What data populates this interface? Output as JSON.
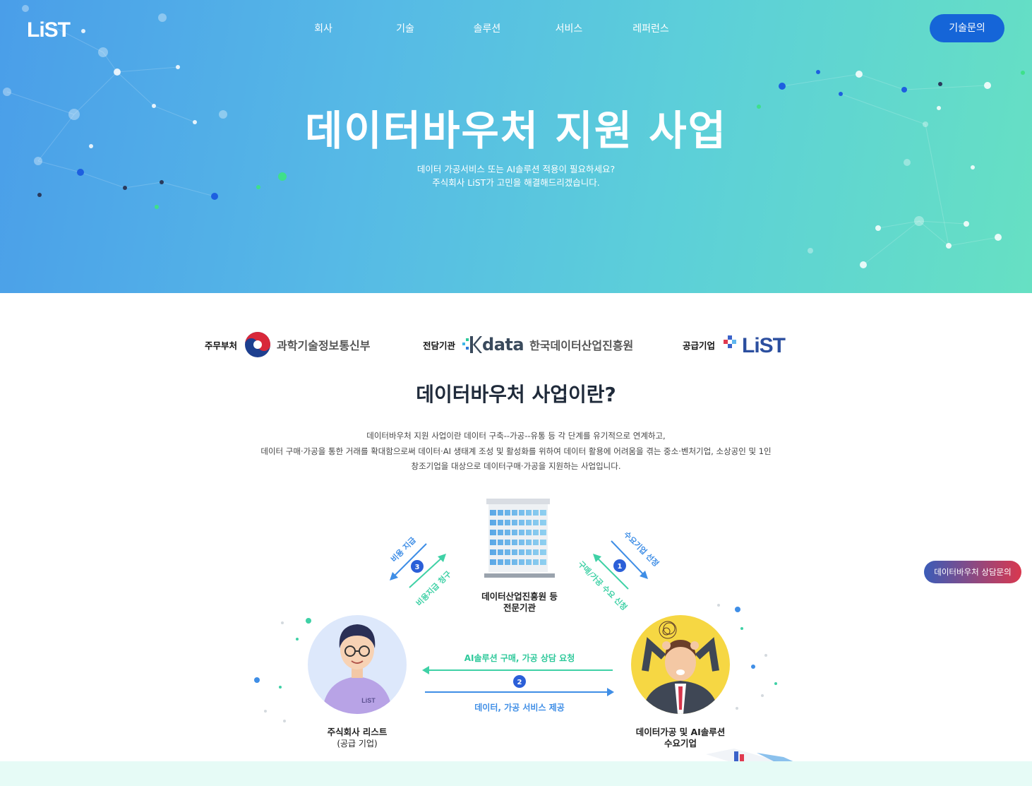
{
  "header": {
    "logo_text": "LiST",
    "nav": [
      "회사",
      "기술",
      "솔루션",
      "서비스",
      "레퍼런스"
    ],
    "cta_label": "기술문의"
  },
  "hero": {
    "title": "데이터바우처 지원 사업",
    "subtitle_line1": "데이터 가공서비스 또는 AI솔루션 적용이 필요하세요?",
    "subtitle_line2": "주식회사 LiST가 고민을 해결해드리겠습니다."
  },
  "partners": [
    {
      "label": "주무부처",
      "name": "과학기술정보통신부"
    },
    {
      "label": "전담기관",
      "brand": "data",
      "name": "한국데이터산업진흥원"
    },
    {
      "label": "공급기업",
      "name": "LiST"
    }
  ],
  "intro": {
    "title": "데이터바우처 사업이란?",
    "desc_line1": "데이터바우처 지원 사업이란 데이터 구축--가공--유통 등 각 단계를 유기적으로 연계하고,",
    "desc_line2": "데이터 구매·가공을 통한 거래를 확대함으로써 데이터·AI 생태계 조성 및 활성화를 위하여 데이터 활용에 어려움을 겪는 중소·벤처기업, 소상공인 및 1인",
    "desc_line3": "창조기업을 대상으로 데이터구매·가공을 지원하는 사업입니다."
  },
  "diagram": {
    "center_line1": "데이터산업진흥원 등",
    "center_line2": "전문기관",
    "supplier_line1": "주식회사 리스트",
    "supplier_line2": "(공급 기업)",
    "demand_line1": "데이터가공 및 AI솔루션",
    "demand_line2": "수요기업",
    "flow_top": "AI솔루션 구매, 가공 상담 요청",
    "flow_bottom": "데이터, 가공 서비스 제공",
    "left_upper": "비용 지급",
    "left_lower": "비용지급 청구",
    "right_upper": "수요기업 선정",
    "right_lower": "구매/가공 수요 신청",
    "step1": "1",
    "step2": "2",
    "step3": "3",
    "shirt_logo": "LiST"
  },
  "floating": {
    "consult_label": "데이터바우처 상담문의"
  },
  "colors": {
    "brand_blue": "#1565d8",
    "arrow_blue": "#3f8ee6",
    "arrow_green": "#3fd1a6",
    "step_badge": "#2b5fd8"
  }
}
